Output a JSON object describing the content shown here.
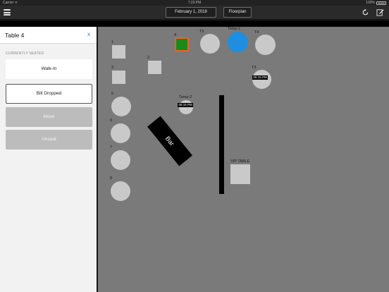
{
  "status_bar": {
    "carrier": "Carrier ᯤ",
    "time": "7:23 PM",
    "battery": "100%"
  },
  "nav": {
    "date_button": "February 1, 2018",
    "view_button": "Floorplan"
  },
  "panel": {
    "title": "Table 4",
    "close_label": "x",
    "section_label": "CURRENTLY SEATED",
    "options": {
      "walk_in": "Walk-In",
      "bill_dropped": "Bill Dropped",
      "move": "Move",
      "unseat": "Unseat"
    }
  },
  "floor": {
    "tables": {
      "t1": "1",
      "t2": "2",
      "t3": "3",
      "t4": "4",
      "t5": "5",
      "t6": "6",
      "t7": "7",
      "t8": "8",
      "T5": "T5",
      "temp1": "Temp-1",
      "T4": "T4",
      "T3": "T3",
      "temp2": "Temp-2",
      "vip": "VIP TABLE"
    },
    "badges": {
      "T3": "06:15 PM",
      "temp2": "06:15 PM"
    },
    "bar_label": "Bar"
  },
  "colors": {
    "selected_table_fill": "#1a8a1a",
    "selected_table_border": "#e8622a",
    "occupied_table_fill": "#1e8fe0",
    "table_fill": "#c9c9c9",
    "floor_bg": "#7a7a7a",
    "close_x": "#2b7fd4"
  },
  "icons": [
    "menu-icon",
    "refresh-icon",
    "edit-icon",
    "close-icon"
  ]
}
